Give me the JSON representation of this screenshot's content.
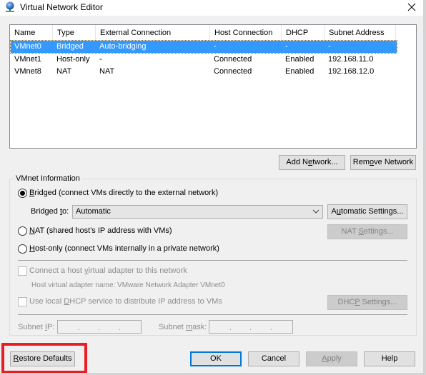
{
  "window": {
    "title": "Virtual Network Editor",
    "icon": "network-globe-icon",
    "close_icon": "close-icon"
  },
  "network_table": {
    "columns": [
      "Name",
      "Type",
      "External Connection",
      "Host Connection",
      "DHCP",
      "Subnet Address"
    ],
    "rows": [
      {
        "name": "VMnet0",
        "type": "Bridged",
        "external": "Auto-bridging",
        "host": "-",
        "dhcp": "-",
        "subnet": "-",
        "selected": true
      },
      {
        "name": "VMnet1",
        "type": "Host-only",
        "external": "-",
        "host": "Connected",
        "dhcp": "Enabled",
        "subnet": "192.168.11.0",
        "selected": false
      },
      {
        "name": "VMnet8",
        "type": "NAT",
        "external": "NAT",
        "host": "Connected",
        "dhcp": "Enabled",
        "subnet": "192.168.12.0",
        "selected": false
      }
    ]
  },
  "table_buttons": {
    "add_network_pre": "Add N",
    "add_network_u": "e",
    "add_network_post": "twork...",
    "remove_network_pre": "Rem",
    "remove_network_u": "o",
    "remove_network_post": "ve Network"
  },
  "vmnet_info": {
    "group_label": "VMnet Information",
    "bridged_radio": {
      "u": "B",
      "rest": "ridged (connect VMs directly to the external network)",
      "checked": true
    },
    "bridged_to_pre": "Bridged ",
    "bridged_to_u": "t",
    "bridged_to_post": "o:",
    "bridged_to_value": "Automatic",
    "automatic_settings_pre": "A",
    "automatic_settings_u": "u",
    "automatic_settings_post": "tomatic Settings...",
    "nat_radio": {
      "u": "N",
      "rest": "AT (shared host's IP address with VMs)",
      "checked": false
    },
    "nat_settings_pre": "NAT ",
    "nat_settings_u": "S",
    "nat_settings_post": "ettings...",
    "hostonly_radio": {
      "u": "H",
      "rest": "ost-only (connect VMs internally in a private network)",
      "checked": false
    },
    "connect_adapter_pre": "Connect a host ",
    "connect_adapter_u": "v",
    "connect_adapter_post": "irtual adapter to this network",
    "connect_adapter_checked": false,
    "adapter_name_label": "Host virtual adapter name: VMware Network Adapter VMnet0",
    "dhcp_pre": "Use local ",
    "dhcp_u": "D",
    "dhcp_post": "HCP service to distribute IP address to VMs",
    "dhcp_checked": false,
    "dhcp_settings_pre": "DHC",
    "dhcp_settings_u": "P",
    "dhcp_settings_post": " Settings...",
    "subnet_ip_pre": "Subnet ",
    "subnet_ip_u": "I",
    "subnet_ip_post": "P:",
    "subnet_ip_value": "",
    "subnet_mask_pre": "Subnet ",
    "subnet_mask_u": "m",
    "subnet_mask_post": "ask:",
    "subnet_mask_value": "",
    "ip_dot": "."
  },
  "footer": {
    "restore_u": "R",
    "restore_post": "estore Defaults",
    "ok": "OK",
    "cancel": "Cancel",
    "apply_u": "A",
    "apply_post": "pply",
    "help": "Help"
  },
  "colors": {
    "selection": "#3399ff",
    "default_button_border": "#0078d7",
    "highlight_annotation": "#ed1c24"
  }
}
